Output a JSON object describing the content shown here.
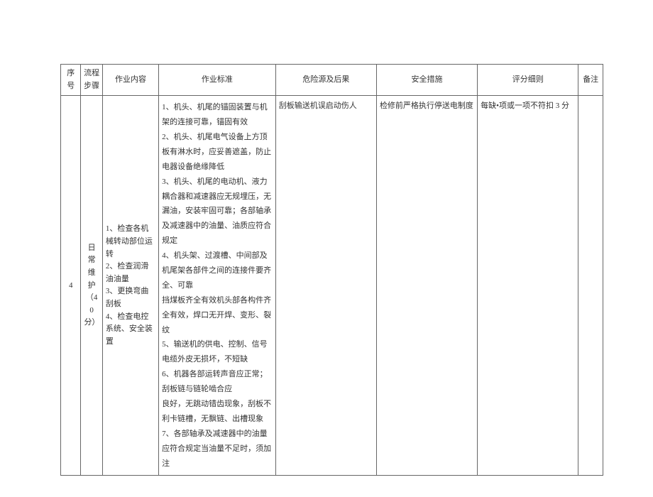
{
  "headers": {
    "seq": "序号",
    "step": "流程步骤",
    "content": "作业内容",
    "standard": "作业标准",
    "risk": "危险源及后果",
    "measure": "安全措施",
    "score": "评分细则",
    "remark": "备注"
  },
  "row": {
    "seq": "4",
    "step": "日常维护（40分）",
    "content": "1、检查各机械转动部位运转\n2、检查润滑油油量\n3、更换弯曲刮板\n4、检查电控系统、安全装置",
    "standard": "1、机头、机尾的锚固装置与机架的连接可靠，锚固有效\n2、机头、机尾电气设备上方顶板有淋水时，应妥善遮盖，防止电器设备绝缘降低\n3、机头、机尾的电动机、液力耦合器和减速器应无规埋压，无漏油，安装牢固可靠；各部轴承及减速器中的油量、油质应符合规定\n4、机头架、过渡槽、中间部及机尾架各部件之间的连接件要齐全、可靠\n挡煤板齐全有效机头部各构件齐全有效，焊口无开焊、变形、裂纹\n5、输送机的供电、控制、信号电缆外皮无损坏，不短缺\n6、机器各部运转声音应正常；刮板链与链轮啮合应\n良好，无跳动错齿现象，刮板不利卡链槽，无飘链、出槽现象\n7、各部轴承及减速器中的油量应符合规定当油量不足时，须加注",
    "risk": "刮板输送机误启动伤人",
    "measure": "检修前严格执行停送电制度",
    "score": "每缺•项或一项不符扣 3 分",
    "remark": ""
  }
}
